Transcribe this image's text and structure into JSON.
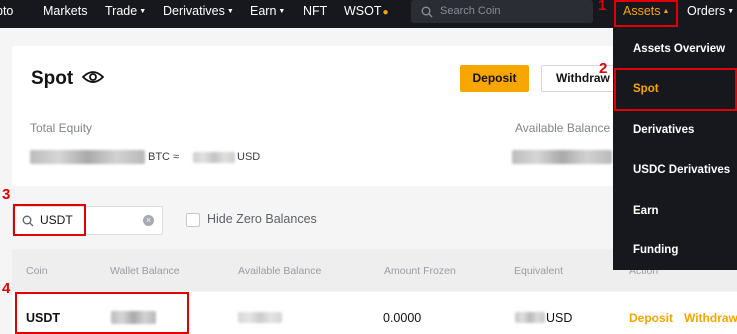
{
  "nav": {
    "items": [
      "pto",
      "Markets",
      "Trade",
      "Derivatives",
      "Earn",
      "NFT",
      "WSOT"
    ],
    "search_placeholder": "Search Coin",
    "assets": "Assets",
    "orders": "Orders"
  },
  "dropdown": {
    "items": [
      "Assets Overview",
      "Spot",
      "Derivatives",
      "USDC Derivatives",
      "Earn",
      "Funding"
    ]
  },
  "spot": {
    "title": "Spot",
    "deposit": "Deposit",
    "withdraw": "Withdraw",
    "total_equity_label": "Total Equity",
    "available_balance_label": "Available Balance",
    "btc_unit": "BTC ≈",
    "usd_unit": "USD"
  },
  "filter": {
    "search_value": "USDT",
    "hide_zero": "Hide Zero Balances"
  },
  "table": {
    "headers": [
      "Coin",
      "Wallet Balance",
      "Available Balance",
      "Amount Frozen",
      "Equivalent",
      "Action"
    ],
    "row": {
      "coin": "USDT",
      "amount_frozen": "0.0000",
      "equivalent_unit": "USD",
      "deposit": "Deposit",
      "withdraw": "Withdraw"
    }
  },
  "annotations": [
    "1",
    "2",
    "3",
    "4"
  ],
  "colors": {
    "accent": "#f7a600",
    "nav_bg": "#17181e",
    "annotation": "#e30000"
  }
}
